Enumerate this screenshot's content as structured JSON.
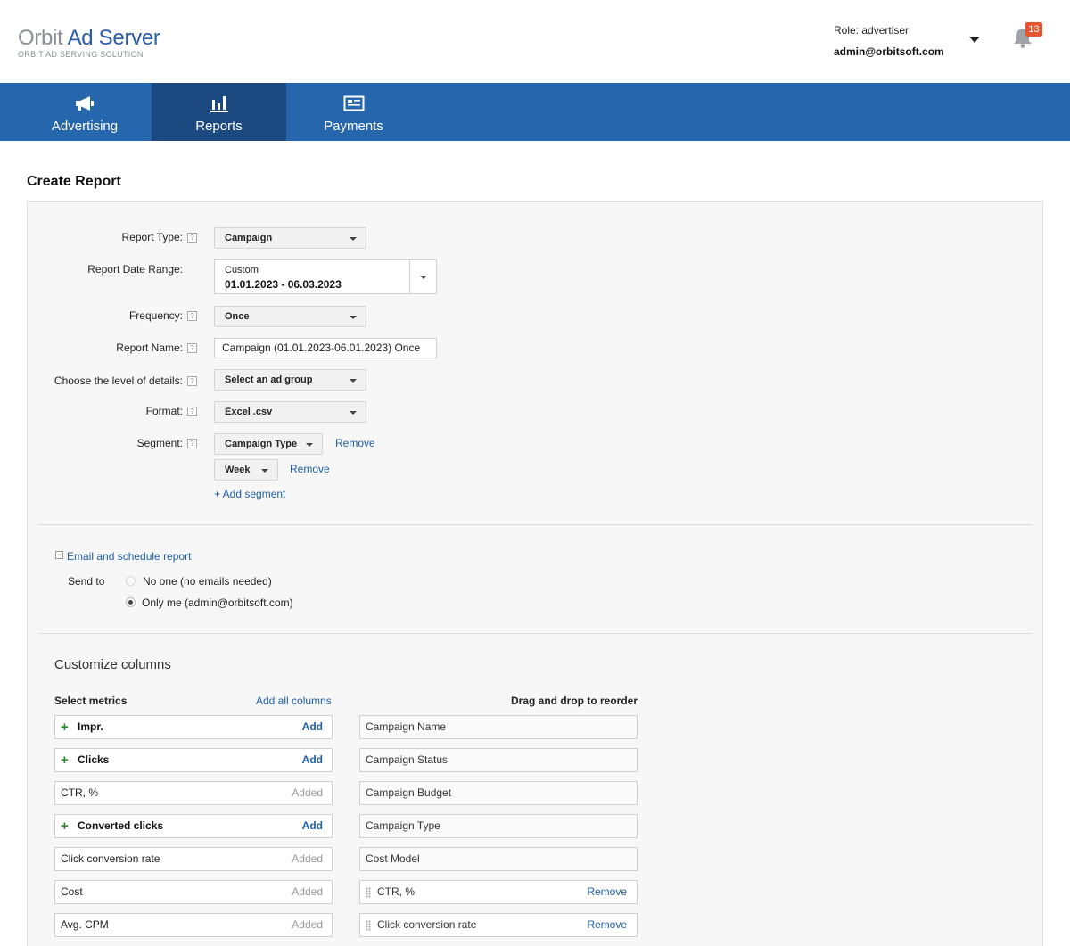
{
  "app": {
    "logo_orbit": "Orbit",
    "logo_ad_server": "Ad Server",
    "logo_tagline": "ORBIT AD SERVING SOLUTION"
  },
  "user": {
    "role": "Role: advertiser",
    "email": "admin@orbitsoft.com",
    "notifications": "13"
  },
  "nav": {
    "items": [
      {
        "label": "Advertising",
        "icon": "megaphone-icon",
        "active": false
      },
      {
        "label": "Reports",
        "icon": "bar-chart-icon",
        "active": true
      },
      {
        "label": "Payments",
        "icon": "credit-card-icon",
        "active": false
      }
    ]
  },
  "page": {
    "title": "Create Report"
  },
  "form": {
    "help_glyph": "?",
    "report_type": {
      "label": "Report Type:",
      "value": "Campaign"
    },
    "date_range": {
      "label": "Report Date Range:",
      "preset": "Custom",
      "value": "01.01.2023 - 06.03.2023"
    },
    "frequency": {
      "label": "Frequency:",
      "value": "Once"
    },
    "report_name": {
      "label": "Report Name:",
      "value": "Campaign  (01.01.2023-06.01.2023) Once"
    },
    "detail_level": {
      "label": "Choose the level of details:",
      "value": "Select an ad group"
    },
    "format": {
      "label": "Format:",
      "value": "Excel .csv"
    },
    "segment": {
      "label": "Segment:",
      "items": [
        {
          "value": "Campaign Type",
          "remove": "Remove"
        },
        {
          "value": "Week",
          "remove": "Remove"
        }
      ],
      "add_label": "+ Add segment"
    }
  },
  "schedule": {
    "toggle_glyph": "−",
    "toggle_label": "Email and schedule report",
    "send_to_label": "Send to",
    "options": [
      {
        "label": "No one (no emails needed)",
        "selected": false
      },
      {
        "label": "Only me (admin@orbitsoft.com)",
        "selected": true
      }
    ]
  },
  "columns": {
    "title": "Customize columns",
    "select_metrics_label": "Select metrics",
    "add_all_label": "Add all columns",
    "reorder_label": "Drag and drop to reorder",
    "metrics": [
      {
        "name": "Impr.",
        "action": "Add",
        "added": false
      },
      {
        "name": "Clicks",
        "action": "Add",
        "added": false
      },
      {
        "name": "CTR, %",
        "action": "Added",
        "added": true
      },
      {
        "name": "Converted clicks",
        "action": "Add",
        "added": false
      },
      {
        "name": "Click conversion rate",
        "action": "Added",
        "added": true
      },
      {
        "name": "Cost",
        "action": "Added",
        "added": true
      },
      {
        "name": "Avg. CPM",
        "action": "Added",
        "added": true
      }
    ],
    "selected": [
      {
        "name": "Campaign Name",
        "removable": false
      },
      {
        "name": "Campaign Status",
        "removable": false
      },
      {
        "name": "Campaign Budget",
        "removable": false
      },
      {
        "name": "Campaign Type",
        "removable": false
      },
      {
        "name": "Cost Model",
        "removable": false
      },
      {
        "name": "CTR, %",
        "removable": true,
        "remove": "Remove"
      },
      {
        "name": "Click conversion rate",
        "removable": true,
        "remove": "Remove"
      }
    ],
    "plus_glyph": "+"
  },
  "colors": {
    "nav_bg": "#2566ac",
    "nav_active": "#1c4a80",
    "link": "#1e5fa8",
    "badge": "#e8542f",
    "add_plus": "#2a8a2a"
  }
}
